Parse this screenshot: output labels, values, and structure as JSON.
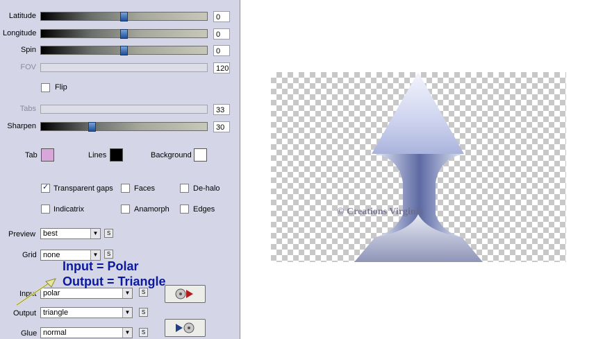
{
  "controls": {
    "latitude": {
      "label": "Latitude",
      "value": "0"
    },
    "longitude": {
      "label": "Longitude",
      "value": "0"
    },
    "spin": {
      "label": "Spin",
      "value": "0"
    },
    "fov": {
      "label": "FOV",
      "value": "120"
    },
    "flip": {
      "label": "Flip",
      "checked": false
    },
    "tabs": {
      "label": "Tabs",
      "value": "33"
    },
    "sharpen": {
      "label": "Sharpen",
      "value": "30"
    }
  },
  "colors": {
    "tab": {
      "label": "Tab",
      "color": "#d9a6d9"
    },
    "lines": {
      "label": "Lines",
      "color": "#000000"
    },
    "background": {
      "label": "Background",
      "color": "#ffffff"
    }
  },
  "options": {
    "transparent_gaps": {
      "label": "Transparent gaps",
      "checked": true
    },
    "faces": {
      "label": "Faces",
      "checked": false
    },
    "de_halo": {
      "label": "De-halo",
      "checked": false
    },
    "indicatrix": {
      "label": "Indicatrix",
      "checked": false
    },
    "anamorph": {
      "label": "Anamorph",
      "checked": false
    },
    "edges": {
      "label": "Edges",
      "checked": false
    }
  },
  "selects": {
    "preview": {
      "label": "Preview",
      "value": "best"
    },
    "grid": {
      "label": "Grid",
      "value": "none"
    },
    "input": {
      "label": "Input",
      "value": "polar"
    },
    "output": {
      "label": "Output",
      "value": "triangle"
    },
    "glue": {
      "label": "Glue",
      "value": "normal"
    }
  },
  "s_button_label": "S",
  "annotation": {
    "line1": "Input = Polar",
    "line2": "Output = Triangle"
  },
  "watermark": "© Creations Virginia"
}
